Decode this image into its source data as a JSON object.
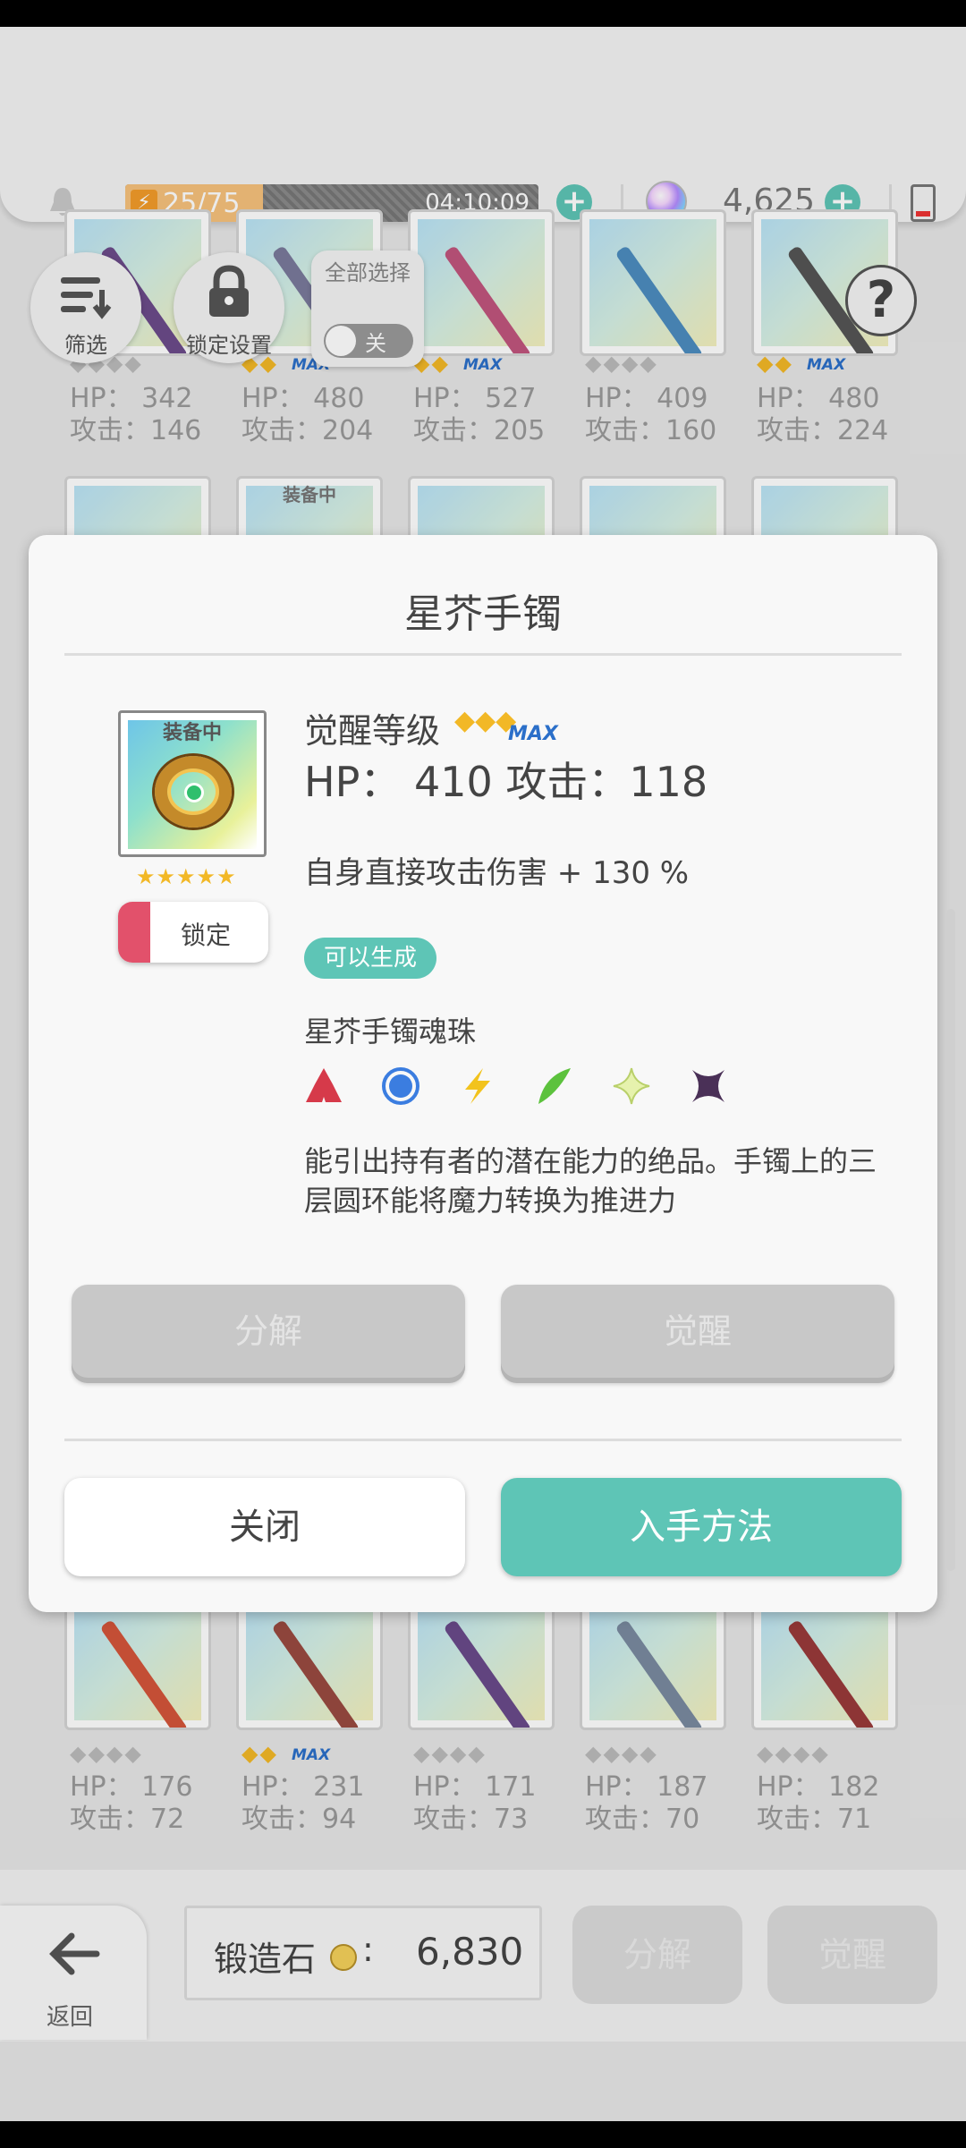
{
  "top": {
    "stamina_count": "25/75",
    "stamina_fraction": 0.333,
    "stamina_timer": "04:10:09",
    "gem_count": "4,625"
  },
  "controls": {
    "filter_label": "筛选",
    "lock_settings_label": "锁定设置",
    "select_all_label": "全部选择",
    "select_all_state": "关",
    "help_glyph": "?"
  },
  "grid_top": [
    {
      "hp": "HP： 342",
      "atk": "攻击：146",
      "awaken": "◆◆◆◆",
      "max": false,
      "color": "#6c4b8a"
    },
    {
      "hp": "HP： 480",
      "atk": "攻击：204",
      "awaken": "◆◆",
      "max": true,
      "color": "#7a7a9c"
    },
    {
      "hp": "HP： 527",
      "atk": "攻击：205",
      "awaken": "◆◆",
      "max": true,
      "color": "#c0557d"
    },
    {
      "hp": "HP： 409",
      "atk": "攻击：160",
      "awaken": "◆◆◆◆",
      "max": false,
      "color": "#4c8dbf"
    },
    {
      "hp": "HP： 480",
      "atk": "攻击：224",
      "awaken": "◆◆",
      "max": true,
      "color": "#555555"
    }
  ],
  "grid_row2_badge": "装备中",
  "grid_bottom": [
    {
      "hp": "HP： 176",
      "atk": "攻击：72",
      "awaken": "◆◆◆◆",
      "max": false,
      "color": "#d4553a"
    },
    {
      "hp": "HP： 231",
      "atk": "攻击：94",
      "awaken": "◆◆",
      "max": true,
      "color": "#9a4a40"
    },
    {
      "hp": "HP： 171",
      "atk": "攻击：73",
      "awaken": "◆◆◆◆",
      "max": false,
      "color": "#6a4a8a"
    },
    {
      "hp": "HP： 187",
      "atk": "攻击：70",
      "awaken": "◆◆◆◆",
      "max": false,
      "color": "#7a8aa0"
    },
    {
      "hp": "HP： 182",
      "atk": "攻击：71",
      "awaken": "◆◆◆◆",
      "max": false,
      "color": "#9a3a3a"
    }
  ],
  "modal": {
    "title": "星芥手镯",
    "item_badge": "装备中",
    "item_stars": "★★★★★",
    "lock_label": "锁定",
    "awaken_label": "觉醒等级",
    "awaken_stars": "◆◆◆",
    "max_text": "MAX",
    "stat_line": "HP： 410   攻击：118",
    "effect": "自身直接攻击伤害 + 130 %",
    "craftable": "可以生成",
    "soul_name": "星芥手镯魂珠",
    "elements": [
      {
        "name": "fire",
        "color": "#d63a4a"
      },
      {
        "name": "water",
        "color": "#3b7de0"
      },
      {
        "name": "thunder",
        "color": "#f2c31d"
      },
      {
        "name": "wind",
        "color": "#5cc23d"
      },
      {
        "name": "light",
        "color": "#d8ec8f"
      },
      {
        "name": "dark",
        "color": "#4a3057"
      }
    ],
    "description": "能引出持有者的潜在能力的绝品。手镯上的三层圆环能将魔力转换为推进力",
    "decompose_label": "分解",
    "awaken_btn_label": "觉醒",
    "close_label": "关闭",
    "acquire_label": "入手方法"
  },
  "bottom": {
    "back_label": "返回",
    "forge_label": "锻造石",
    "forge_colon": ":",
    "forge_value": "6,830",
    "decompose_label": "分解",
    "awaken_label": "觉醒"
  },
  "colors": {
    "accent": "#5ec5b6",
    "lock_red": "#e2516b",
    "gold": "#f2b826"
  }
}
